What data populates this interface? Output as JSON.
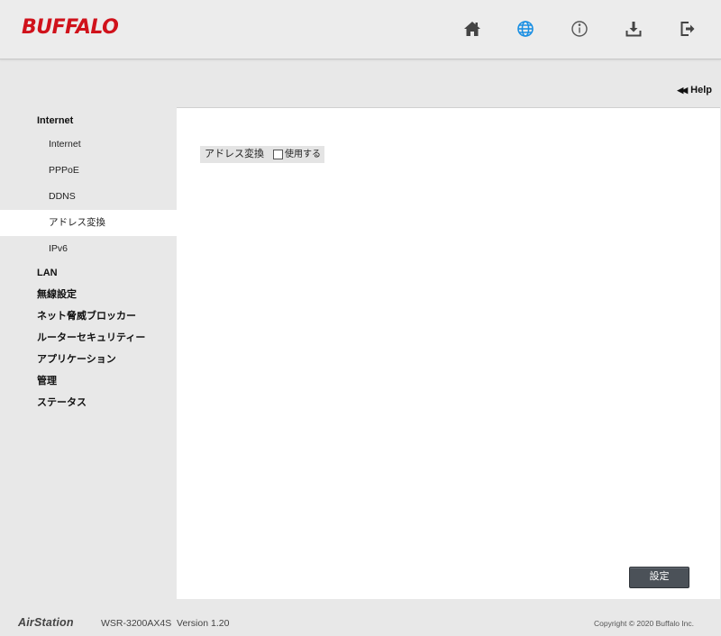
{
  "header": {
    "logo": "BUFFALO",
    "icons": [
      "home-icon",
      "globe-icon",
      "info-icon",
      "download-icon",
      "logout-icon"
    ],
    "accent_color": "#1a8fe3",
    "logo_color": "#d0121b"
  },
  "help": {
    "arrows": "◀◀",
    "label": "Help"
  },
  "sidebar": {
    "groups": [
      {
        "label": "Internet",
        "items": [
          "Internet",
          "PPPoE",
          "DDNS",
          "アドレス変換",
          "IPv6"
        ],
        "active_item": "アドレス変換"
      },
      {
        "label": "LAN"
      },
      {
        "label": "無線設定"
      },
      {
        "label": "ネット脅威ブロッカー"
      },
      {
        "label": "ルーターセキュリティー"
      },
      {
        "label": "アプリケーション"
      },
      {
        "label": "管理"
      },
      {
        "label": "ステータス"
      }
    ]
  },
  "main": {
    "setting_label": "アドレス変換",
    "checkbox_label": "使用する",
    "checkbox_checked": false,
    "submit_label": "設定"
  },
  "footer": {
    "brand": "AirStation",
    "model": "WSR-3200AX4S  Version 1.20",
    "copyright": "Copyright © 2020 Buffalo Inc."
  }
}
